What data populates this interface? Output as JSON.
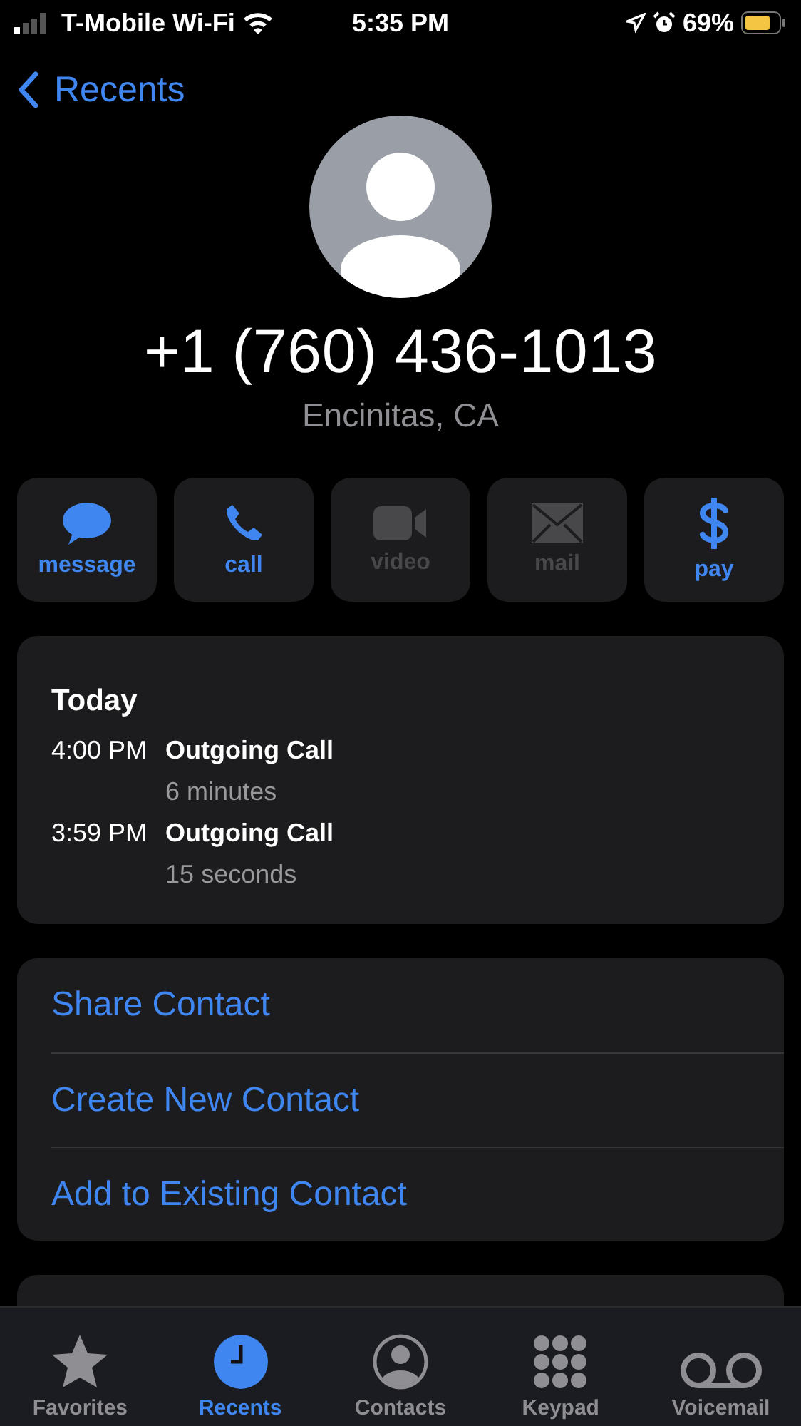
{
  "status_bar": {
    "carrier": "T-Mobile Wi-Fi",
    "time": "5:35 PM",
    "battery": "69%"
  },
  "nav": {
    "back": "Recents"
  },
  "contact": {
    "number": "+1 (760) 436-1013",
    "location": "Encinitas, CA"
  },
  "actions": [
    {
      "kind": "message",
      "label": "message",
      "disabled": false
    },
    {
      "kind": "call",
      "label": "call",
      "disabled": false
    },
    {
      "kind": "video",
      "label": "video",
      "disabled": true
    },
    {
      "kind": "mail",
      "label": "mail",
      "disabled": true
    },
    {
      "kind": "pay",
      "label": "pay",
      "disabled": false
    }
  ],
  "history": {
    "heading": "Today",
    "calls": [
      {
        "time": "4:00 PM",
        "type": "Outgoing Call",
        "duration": "6 minutes"
      },
      {
        "time": "3:59 PM",
        "type": "Outgoing Call",
        "duration": "15 seconds"
      }
    ]
  },
  "options": [
    "Share Contact",
    "Create New Contact",
    "Add to Existing Contact"
  ],
  "tabs": [
    {
      "kind": "favorites",
      "label": "Favorites",
      "selected": false
    },
    {
      "kind": "recents",
      "label": "Recents",
      "selected": true
    },
    {
      "kind": "contacts",
      "label": "Contacts",
      "selected": false
    },
    {
      "kind": "keypad",
      "label": "Keypad",
      "selected": false
    },
    {
      "kind": "voicemail",
      "label": "Voicemail",
      "selected": false
    }
  ]
}
